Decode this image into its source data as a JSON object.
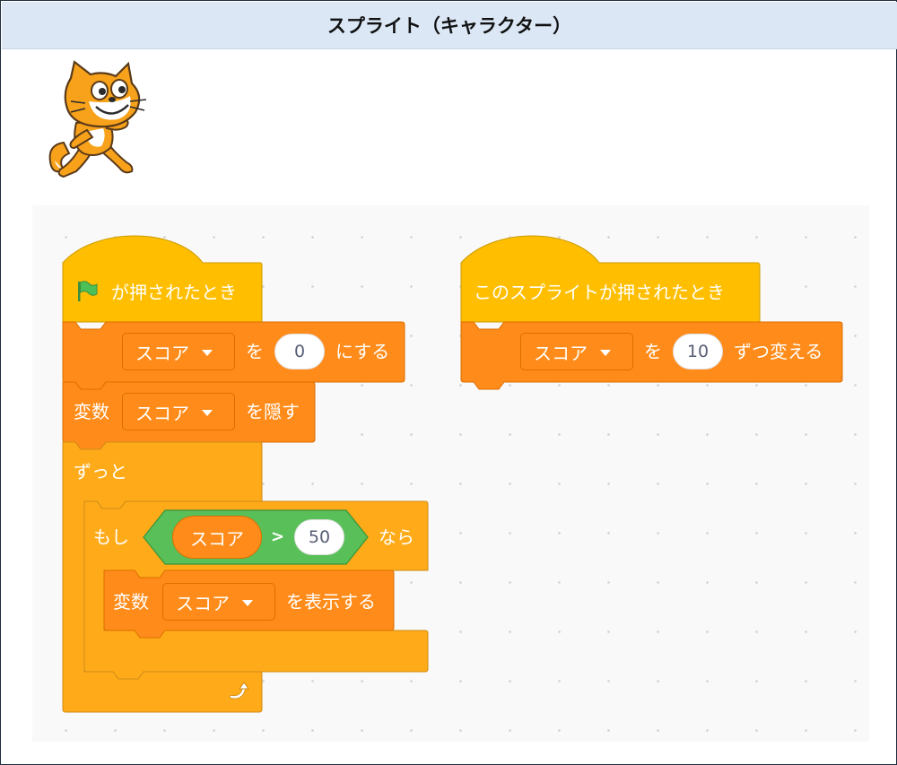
{
  "header": {
    "title": "スプライト（キャラクター）"
  },
  "sprite": {
    "name": "cat-sprite"
  },
  "script1": {
    "hat_label": "が押されたとき",
    "set": {
      "variable": "スコア",
      "to_label": "を",
      "value": "0",
      "suffix": "にする"
    },
    "hide": {
      "prefix": "変数",
      "variable": "スコア",
      "suffix": "を隠す"
    },
    "forever_label": "ずっと",
    "if": {
      "prefix": "もし",
      "reporter": "スコア",
      "op": ">",
      "value": "50",
      "suffix": "なら"
    },
    "show": {
      "prefix": "変数",
      "variable": "スコア",
      "suffix": "を表示する"
    }
  },
  "script2": {
    "hat_label": "このスプライトが押されたとき",
    "change": {
      "variable": "スコア",
      "by_label": "を",
      "value": "10",
      "suffix": "ずつ変える"
    }
  },
  "colors": {
    "events": "#ffbf00",
    "variables": "#ff8c1a",
    "control": "#ffab19",
    "operators": "#59c059",
    "flag": "#4cbf56"
  },
  "icons": {
    "flag": "green-flag-icon",
    "loop": "loop-arrow-icon",
    "dropdown": "dropdown-triangle-icon"
  }
}
